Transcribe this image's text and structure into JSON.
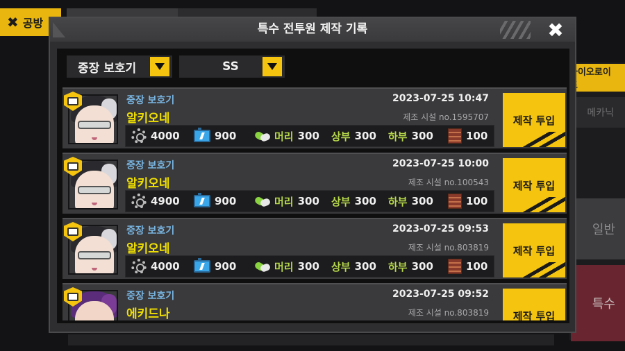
{
  "background": {
    "left_tab_label": "공방",
    "right_tabs": [
      "바이오로이드",
      "메카닉",
      "일반",
      "특수"
    ]
  },
  "modal": {
    "title": "특수 전투원 제작 기록",
    "filters": {
      "type": "중장 보호기",
      "grade": "SS"
    },
    "button_label": "제작 투입",
    "resource_labels": {
      "head": "머리",
      "upper": "상부",
      "lower": "하부"
    },
    "records": [
      {
        "type": "중장 보호기",
        "name": "알키오네",
        "datetime": "2023-07-25 10:47",
        "facility": "제조 시설 no.1595707",
        "parts": "4000",
        "nutrient": "900",
        "power_head": "300",
        "power_upper": "300",
        "power_lower": "300",
        "chip": "100",
        "portrait": "portrait-alcyone"
      },
      {
        "type": "중장 보호기",
        "name": "알키오네",
        "datetime": "2023-07-25 10:00",
        "facility": "제조 시설 no.100543",
        "parts": "4900",
        "nutrient": "900",
        "power_head": "300",
        "power_upper": "300",
        "power_lower": "300",
        "chip": "100",
        "portrait": "portrait-alcyone"
      },
      {
        "type": "중장 보호기",
        "name": "알키오네",
        "datetime": "2023-07-25 09:53",
        "facility": "제조 시설 no.803819",
        "parts": "4000",
        "nutrient": "900",
        "power_head": "300",
        "power_upper": "300",
        "power_lower": "300",
        "chip": "100",
        "portrait": "portrait-alcyone"
      },
      {
        "type": "중장 보호기",
        "name": "에키드나",
        "datetime": "2023-07-25 09:52",
        "facility": "제조 시설 no.803819",
        "portrait": "portrait-echidna"
      }
    ]
  },
  "colors": {
    "accent": "#f5c40e",
    "name_text": "#f0e000",
    "type_text": "#78b4e0",
    "label_green": "#b6d84a"
  }
}
